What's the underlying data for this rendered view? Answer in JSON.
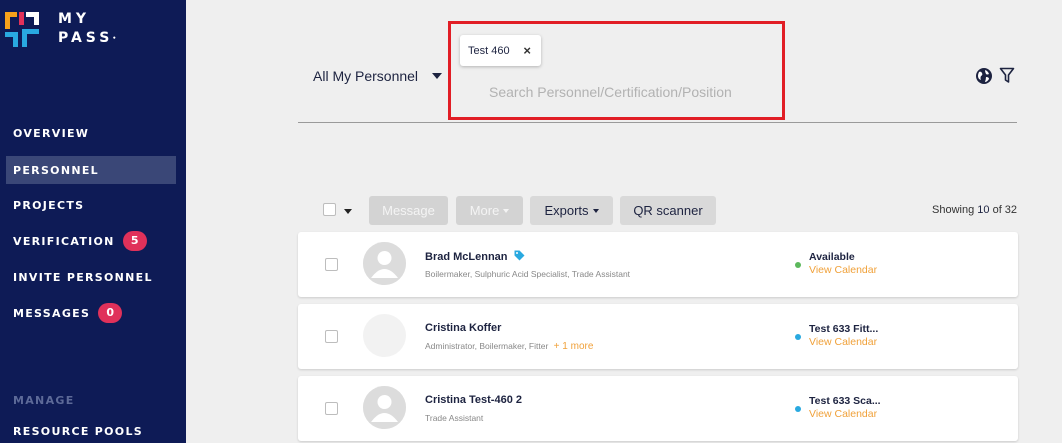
{
  "app": {
    "logo_text_line1": "MY",
    "logo_text_line2": "PASS"
  },
  "sidebar": {
    "items": [
      {
        "label": "OVERVIEW"
      },
      {
        "label": "PERSONNEL",
        "active": true
      },
      {
        "label": "PROJECTS"
      },
      {
        "label": "VERIFICATION",
        "badge": "5"
      },
      {
        "label": "INVITE PERSONNEL"
      },
      {
        "label": "MESSAGES",
        "badge": "0"
      }
    ],
    "section_label": "MANAGE",
    "section_items": [
      {
        "label": "RESOURCE POOLS"
      }
    ]
  },
  "header": {
    "filter_selected": "All My Personnel",
    "search_chip": "Test 460",
    "search_placeholder": "Search Personnel/Certification/Position",
    "icons": [
      "globe-icon",
      "filter-icon"
    ]
  },
  "toolbar": {
    "message_label": "Message",
    "more_label": "More",
    "exports_label": "Exports",
    "qr_label": "QR scanner",
    "showing_prefix": "Showing ",
    "showing_count": "10",
    "showing_suffix": " of 32"
  },
  "personnel": [
    {
      "name": "Brad McLennan",
      "roles": "Boilermaker, Sulphuric Acid Specialist, Trade Assistant",
      "more": "",
      "status": "Available",
      "status_color": "#5cb85c",
      "calendar_link": "View Calendar",
      "has_tag": true,
      "avatar": "placeholder"
    },
    {
      "name": "Cristina Koffer",
      "roles": "Administrator, Boilermaker, Fitter",
      "more": "+ 1 more",
      "status": "Test 633 Fitt...",
      "status_color": "#29a9e0",
      "calendar_link": "View Calendar",
      "has_tag": false,
      "avatar": "blank"
    },
    {
      "name": "Cristina Test-460 2",
      "roles": "Trade Assistant",
      "more": "",
      "status": "Test 633 Sca...",
      "status_color": "#29a9e0",
      "calendar_link": "View Calendar",
      "has_tag": false,
      "avatar": "placeholder"
    }
  ],
  "colors": {
    "sidebar_bg": "#0e1b56",
    "accent": "#f0a13a",
    "badge": "#e0315a",
    "highlight_border": "#e11d25"
  }
}
